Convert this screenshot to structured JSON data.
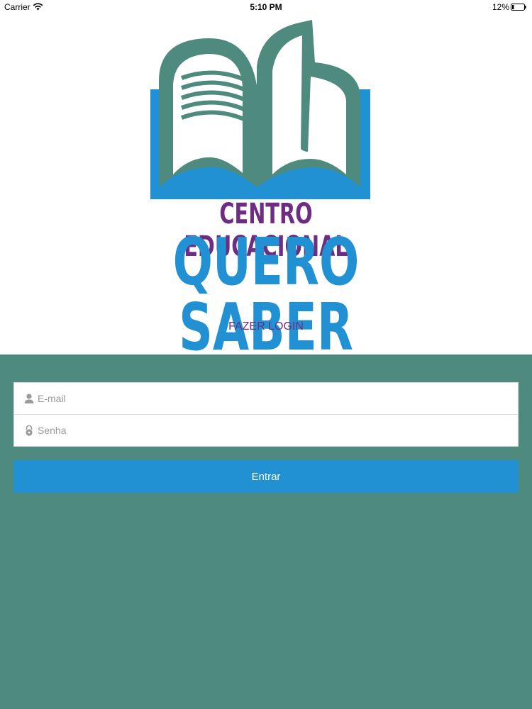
{
  "status_bar": {
    "carrier": "Carrier",
    "time": "5:10 PM",
    "battery": "12%"
  },
  "logo": {
    "line1": "CENTRO EDUCACIONAL",
    "line2": "QUERO SABER",
    "colors": {
      "green": "#4f8a7e",
      "blue": "#2291d3",
      "purple": "#6c2d82"
    }
  },
  "login": {
    "title": "FAZER LOGIN",
    "email_placeholder": "E-mail",
    "password_placeholder": "Senha",
    "submit_label": "Entrar"
  },
  "icons": [
    "wifi-icon",
    "battery-icon",
    "user-icon",
    "lock-icon"
  ]
}
